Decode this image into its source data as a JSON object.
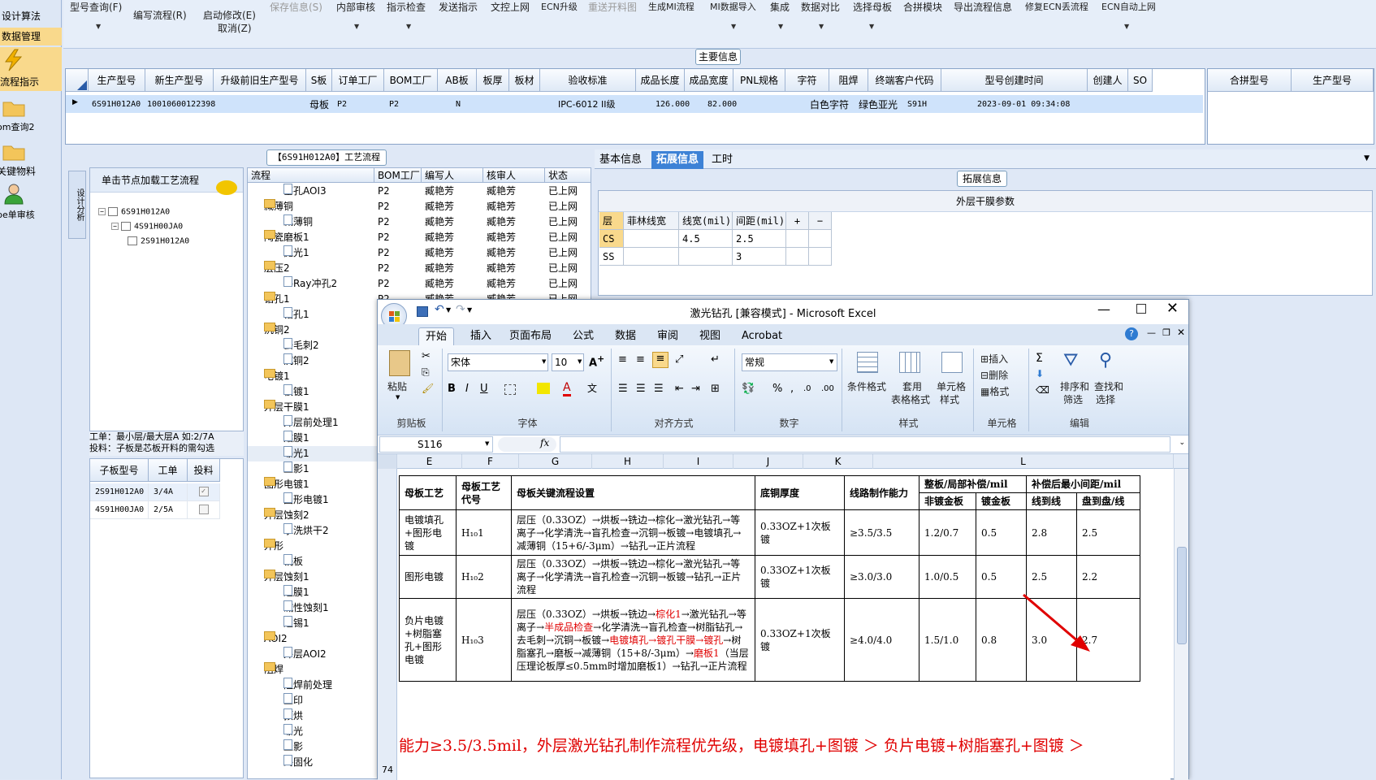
{
  "leftnav": {
    "items": [
      {
        "label": "设计算法",
        "icon": "",
        "highlight": false
      },
      {
        "label": "数据管理",
        "icon": "",
        "highlight": true
      },
      {
        "label": "流程指示",
        "icon": "lightning-icon",
        "highlight": true
      },
      {
        "label": "om查询2",
        "icon": "folder-icon",
        "highlight": false
      },
      {
        "label": "关键物料",
        "icon": "folder-icon",
        "highlight": false
      },
      {
        "label": "pe单审核",
        "icon": "user-icon",
        "highlight": false
      }
    ]
  },
  "toolbar": {
    "items": [
      {
        "label": "型号查询(F)",
        "disabled": false,
        "arrow": true
      },
      {
        "label": "编写流程(R)",
        "disabled": false,
        "arrow": false
      },
      {
        "label": "启动修改(E)",
        "disabled": false,
        "arrow": false
      },
      {
        "label": "保存信息(S)",
        "disabled": true,
        "arrow": false
      },
      {
        "label": "内部审核",
        "disabled": false,
        "arrow": true
      },
      {
        "label": "指示检查",
        "disabled": false,
        "arrow": true
      },
      {
        "label": "发送指示",
        "disabled": false,
        "arrow": false
      },
      {
        "label": "文控上网",
        "disabled": false,
        "arrow": false
      },
      {
        "label": "ECN升级",
        "disabled": false,
        "arrow": false
      },
      {
        "label": "重送开料图",
        "disabled": true,
        "arrow": false
      },
      {
        "label": "生成MI流程",
        "disabled": false,
        "arrow": false
      },
      {
        "label": "MI数据导入",
        "disabled": false,
        "arrow": true
      },
      {
        "label": "集成",
        "disabled": false,
        "arrow": true
      },
      {
        "label": "数据对比",
        "disabled": false,
        "arrow": true
      },
      {
        "label": "选择母板",
        "disabled": false,
        "arrow": true
      },
      {
        "label": "合拼模块",
        "disabled": false,
        "arrow": false
      },
      {
        "label": "导出流程信息",
        "disabled": false,
        "arrow": false
      },
      {
        "label": "修复ECN丢流程",
        "disabled": false,
        "arrow": false
      },
      {
        "label": "ECN自动上网",
        "disabled": false,
        "arrow": true
      }
    ],
    "cancel_label": "取消(Z)"
  },
  "main_info": {
    "title": "主要信息",
    "columns": [
      "生产型号",
      "新生产型号",
      "升级前旧生产型号",
      "S板",
      "订单工厂",
      "BOM工厂",
      "AB板",
      "板厚",
      "板材",
      "验收标准",
      "成品长度",
      "成品宽度",
      "PNL规格",
      "字符",
      "阻焊",
      "终端客户代码",
      "型号创建时间",
      "创建人",
      "SO"
    ],
    "row": [
      "6S91H012A0",
      "10010600122398",
      "",
      "母板",
      "P2",
      "P2",
      "N",
      "",
      "",
      "IPC-6012 II级",
      "126.000",
      "82.000",
      "",
      "白色字符",
      "绿色亚光",
      "S91H",
      "2023-09-01 09:34:08",
      "",
      ""
    ]
  },
  "merge_grid": {
    "columns": [
      "合拼型号",
      "生产型号"
    ]
  },
  "left_tree": {
    "side_tab": "设计分析",
    "header": "单击节点加载工艺流程",
    "nodes": [
      "6S91H012A0",
      "4S91H00JA0",
      "2S91H012A0"
    ]
  },
  "work_note": {
    "line1": "工单：最小层/最大层A 如:2/7A",
    "line2": "投料：子板是芯板开料的需勾选"
  },
  "sub_grid": {
    "columns": [
      "子板型号",
      "工单",
      "投料"
    ],
    "rows": [
      {
        "model": "2S91H012A0",
        "order": "3/4A",
        "feed": true
      },
      {
        "model": "4S91H00JA0",
        "order": "2/5A",
        "feed": false
      }
    ]
  },
  "process": {
    "title": "【6S91H012A0】工艺流程",
    "columns": [
      "流程",
      "BOM工厂",
      "编写人",
      "核审人",
      "状态"
    ],
    "rows": [
      {
        "level": 2,
        "label": "塞孔AOI3",
        "folder": false,
        "bom": "P2",
        "writer": "臧艳芳",
        "reviewer": "臧艳芳",
        "status": "已上网"
      },
      {
        "level": 1,
        "label": "减薄铜",
        "folder": true,
        "bom": "P2",
        "writer": "臧艳芳",
        "reviewer": "臧艳芳",
        "status": "已上网"
      },
      {
        "level": 2,
        "label": "减薄铜",
        "folder": false,
        "bom": "P2",
        "writer": "臧艳芳",
        "reviewer": "臧艳芳",
        "status": "已上网"
      },
      {
        "level": 1,
        "label": "陶瓷磨板1",
        "folder": true,
        "bom": "P2",
        "writer": "臧艳芳",
        "reviewer": "臧艳芳",
        "status": "已上网"
      },
      {
        "level": 2,
        "label": "抛光1",
        "folder": false,
        "bom": "P2",
        "writer": "臧艳芳",
        "reviewer": "臧艳芳",
        "status": "已上网"
      },
      {
        "level": 1,
        "label": "层压2",
        "folder": true,
        "bom": "P2",
        "writer": "臧艳芳",
        "reviewer": "臧艳芳",
        "status": "已上网"
      },
      {
        "level": 2,
        "label": "X-Ray冲孔2",
        "folder": false,
        "bom": "P2",
        "writer": "臧艳芳",
        "reviewer": "臧艳芳",
        "status": "已上网"
      },
      {
        "level": 1,
        "label": "钻孔1",
        "folder": true,
        "bom": "P2",
        "writer": "臧艳芳",
        "reviewer": "臧艳芳",
        "status": "已上网"
      },
      {
        "level": 2,
        "label": "钻孔1",
        "folder": false,
        "bom": "",
        "writer": "",
        "reviewer": "",
        "status": ""
      },
      {
        "level": 1,
        "label": "沉铜2",
        "folder": true,
        "bom": "",
        "writer": "",
        "reviewer": "",
        "status": ""
      },
      {
        "level": 2,
        "label": "去毛刺2",
        "folder": false,
        "bom": "",
        "writer": "",
        "reviewer": "",
        "status": ""
      },
      {
        "level": 2,
        "label": "沉铜2",
        "folder": false,
        "bom": "",
        "writer": "",
        "reviewer": "",
        "status": ""
      },
      {
        "level": 1,
        "label": "电镀1",
        "folder": true,
        "bom": "",
        "writer": "",
        "reviewer": "",
        "status": ""
      },
      {
        "level": 2,
        "label": "板镀1",
        "folder": false,
        "bom": "",
        "writer": "",
        "reviewer": "",
        "status": ""
      },
      {
        "level": 1,
        "label": "外层干膜1",
        "folder": true,
        "bom": "",
        "writer": "",
        "reviewer": "",
        "status": ""
      },
      {
        "level": 2,
        "label": "外层前处理1",
        "folder": false,
        "bom": "",
        "writer": "",
        "reviewer": "",
        "status": ""
      },
      {
        "level": 2,
        "label": "贴膜1",
        "folder": false,
        "bom": "",
        "writer": "",
        "reviewer": "",
        "status": ""
      },
      {
        "level": 2,
        "label": "曝光1",
        "folder": false,
        "bom": "",
        "writer": "",
        "reviewer": "",
        "status": ""
      },
      {
        "level": 2,
        "label": "显影1",
        "folder": false,
        "bom": "",
        "writer": "",
        "reviewer": "",
        "status": ""
      },
      {
        "level": 1,
        "label": "图形电镀1",
        "folder": true,
        "bom": "",
        "writer": "",
        "reviewer": "",
        "status": ""
      },
      {
        "level": 2,
        "label": "图形电镀1",
        "folder": false,
        "bom": "",
        "writer": "",
        "reviewer": "",
        "status": ""
      },
      {
        "level": 1,
        "label": "外层蚀刻2",
        "folder": true,
        "bom": "",
        "writer": "",
        "reviewer": "",
        "status": ""
      },
      {
        "level": 2,
        "label": "水洗烘干2",
        "folder": false,
        "bom": "",
        "writer": "",
        "reviewer": "",
        "status": ""
      },
      {
        "level": 1,
        "label": "外形",
        "folder": true,
        "bom": "",
        "writer": "",
        "reviewer": "",
        "status": ""
      },
      {
        "level": 2,
        "label": "铣板",
        "folder": false,
        "bom": "",
        "writer": "",
        "reviewer": "",
        "status": ""
      },
      {
        "level": 1,
        "label": "外层蚀刻1",
        "folder": true,
        "bom": "",
        "writer": "",
        "reviewer": "",
        "status": ""
      },
      {
        "level": 2,
        "label": "退膜1",
        "folder": false,
        "bom": "",
        "writer": "",
        "reviewer": "",
        "status": ""
      },
      {
        "level": 2,
        "label": "碱性蚀刻1",
        "folder": false,
        "bom": "",
        "writer": "",
        "reviewer": "",
        "status": ""
      },
      {
        "level": 2,
        "label": "退锡1",
        "folder": false,
        "bom": "",
        "writer": "",
        "reviewer": "",
        "status": ""
      },
      {
        "level": 1,
        "label": "AOI2",
        "folder": true,
        "bom": "",
        "writer": "",
        "reviewer": "",
        "status": ""
      },
      {
        "level": 2,
        "label": "外层AOI2",
        "folder": false,
        "bom": "",
        "writer": "",
        "reviewer": "",
        "status": ""
      },
      {
        "level": 1,
        "label": "阻焊",
        "folder": true,
        "bom": "",
        "writer": "",
        "reviewer": "",
        "status": ""
      },
      {
        "level": 2,
        "label": "阻焊前处理",
        "folder": false,
        "bom": "",
        "writer": "",
        "reviewer": "",
        "status": ""
      },
      {
        "level": 2,
        "label": "丝印",
        "folder": false,
        "bom": "",
        "writer": "",
        "reviewer": "",
        "status": ""
      },
      {
        "level": 2,
        "label": "预烘",
        "folder": false,
        "bom": "",
        "writer": "",
        "reviewer": "",
        "status": ""
      },
      {
        "level": 2,
        "label": "曝光",
        "folder": false,
        "bom": "",
        "writer": "",
        "reviewer": "",
        "status": ""
      },
      {
        "level": 2,
        "label": "显影",
        "folder": false,
        "bom": "",
        "writer": "",
        "reviewer": "",
        "status": ""
      },
      {
        "level": 2,
        "label": "终固化",
        "folder": false,
        "bom": "",
        "writer": "",
        "reviewer": "",
        "status": ""
      }
    ]
  },
  "right_tabs": {
    "tabs": [
      "基本信息",
      "拓展信息",
      "工时"
    ],
    "selected": 1
  },
  "ext_info": {
    "title": "拓展信息",
    "section": "外层干膜参数",
    "columns": [
      "层",
      "菲林线宽",
      "线宽(mil)",
      "间距(mil)",
      "+",
      "−"
    ],
    "rows": [
      {
        "layer": "CS",
        "film": "",
        "width": "4.5",
        "space": "2.5"
      },
      {
        "layer": "SS",
        "film": "",
        "width": "",
        "space": "3"
      }
    ]
  },
  "excel": {
    "title": "激光钻孔  [兼容模式] - Microsoft Excel",
    "tabs": [
      "开始",
      "插入",
      "页面布局",
      "公式",
      "数据",
      "审阅",
      "视图",
      "Acrobat"
    ],
    "font_name": "宋体",
    "font_size": "10",
    "number_format": "常规",
    "name_box": "S116",
    "fx": "fx",
    "groups": {
      "clipboard": "剪贴板",
      "font": "字体",
      "align": "对齐方式",
      "number": "数字",
      "styles": "样式",
      "cells": "单元格",
      "edit": "编辑"
    },
    "buttons": {
      "paste": "粘贴",
      "cond_format": "条件格式",
      "table_format1": "套用",
      "table_format2": "表格格式",
      "cell_style1": "单元格",
      "cell_style2": "样式",
      "insert": "插入",
      "delete": "删除",
      "format": "格式",
      "sort1": "排序和",
      "sort2": "筛选",
      "find1": "查找和",
      "find2": "选择"
    },
    "columns": [
      "E",
      "F",
      "G",
      "H",
      "I",
      "J",
      "K",
      "L"
    ],
    "row_number": "74",
    "table": {
      "h_mother": "母板工艺",
      "h_code": "母板工艺代号",
      "h_flow": "母板关键流程设置",
      "h_copper": "底铜厚度",
      "h_capab": "线路制作能力",
      "h_comp": "整板/局部补偿/mil",
      "h_gap": "补偿后最小间距/mil",
      "h_nongold": "非镀金板",
      "h_gold": "镀金板",
      "h_l2l": "线到线",
      "h_p2p": "盘到盘/线",
      "rows": [
        {
          "name": "电镀填孔+图形电镀",
          "code": "H₁₀1",
          "flow": "层压（0.33OZ）→烘板→铣边→棕化→激光钻孔→等离子→化学清洗→盲孔检查→沉铜→板镀→电镀填孔→减薄铜（15+6/-3μm）→钻孔→正片流程",
          "copper": "0.33OZ+1次板镀",
          "capab": "≥3.5/3.5",
          "nongold": "1.2/0.7",
          "gold": "0.5",
          "l2l": "2.8",
          "p2p": "2.5"
        },
        {
          "name": "图形电镀",
          "code": "H₁₀2",
          "flow": "层压（0.33OZ）→烘板→铣边→棕化→激光钻孔→等离子→化学清洗→盲孔检查→沉铜→板镀→钻孔→正片流程",
          "copper": "0.33OZ+1次板镀",
          "capab": "≥3.0/3.0",
          "nongold": "1.0/0.5",
          "gold": "0.5",
          "l2l": "2.5",
          "p2p": "2.2"
        },
        {
          "name": "负片电镀+树脂塞孔+图形电镀",
          "code": "H₁₀3",
          "flow_parts": [
            {
              "t": "层压（0.33OZ）→烘板→铣边→",
              "red": false
            },
            {
              "t": "棕化1",
              "red": true
            },
            {
              "t": "→激光钻孔→等离子→",
              "red": false
            },
            {
              "t": "半成品检查",
              "red": true
            },
            {
              "t": "→化学清洗→盲孔检查→树脂钻孔→去毛刺→沉铜→板镀→",
              "red": false
            },
            {
              "t": "电镀填孔→镀孔干膜→镀孔",
              "red": true
            },
            {
              "t": "→树脂塞孔→磨板→减薄铜（15+8/-3μm）→",
              "red": false
            },
            {
              "t": "磨板1",
              "red": true
            },
            {
              "t": "（当层压理论板厚≤0.5mm时增加磨板1）→钻孔→正片流程",
              "red": false
            }
          ],
          "copper": "0.33OZ+1次板镀",
          "capab": "≥4.0/4.0",
          "nongold": "1.5/1.0",
          "gold": "0.8",
          "l2l": "3.0",
          "p2p": "2.7"
        }
      ]
    },
    "note": "能力≥3.5/3.5mil，外层激光钻孔制作流程优先级，电镀填孔+图镀 ＞ 负片电镀+树脂塞孔+图镀 ＞"
  },
  "colors": {
    "accent": "#3d82d6",
    "highlight": "#f9d98c",
    "red": "#e00000",
    "selection": "#cfe3fb"
  }
}
